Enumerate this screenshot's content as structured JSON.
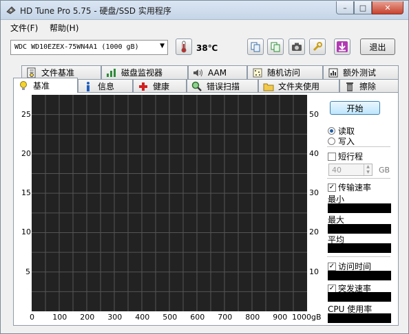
{
  "window": {
    "title": "HD Tune Pro 5.75 - 硬盘/SSD 实用程序",
    "minimize": "–",
    "maximize": "□",
    "close": "✕"
  },
  "menu": {
    "file": "文件(F)",
    "help": "帮助(H)"
  },
  "toolbar": {
    "drive": "WDC WD10EZEX-75WN4A1 (1000 gB)",
    "temperature": "38℃",
    "exit_label": "退出",
    "icons": [
      "copy-icon",
      "copy-all-icon",
      "camera-icon",
      "options-icon",
      "save-icon"
    ]
  },
  "tabs_top": [
    {
      "label": "文件基准",
      "icon": "file-benchmark-icon"
    },
    {
      "label": "磁盘监视器",
      "icon": "disk-monitor-icon"
    },
    {
      "label": "AAM",
      "icon": "speaker-icon"
    },
    {
      "label": "随机访问",
      "icon": "random-access-icon"
    },
    {
      "label": "额外测试",
      "icon": "extra-tests-icon"
    }
  ],
  "tabs_bottom": [
    {
      "label": "基准",
      "icon": "lightbulb-icon",
      "active": true
    },
    {
      "label": "信息",
      "icon": "info-icon"
    },
    {
      "label": "健康",
      "icon": "health-cross-icon"
    },
    {
      "label": "错误扫描",
      "icon": "magnifier-icon"
    },
    {
      "label": "文件夹使用",
      "icon": "folder-icon"
    },
    {
      "label": "擦除",
      "icon": "trash-icon"
    }
  ],
  "benchmark": {
    "start_label": "开始",
    "read_label": "读取",
    "write_label": "写入",
    "mode_selected": "read",
    "short_stroke_label": "短行程",
    "short_stroke_checked": false,
    "short_stroke_value": "40",
    "short_stroke_unit": "GB",
    "transfer_rate_label": "传输速率",
    "transfer_rate_checked": true,
    "min_label": "最小",
    "max_label": "最大",
    "avg_label": "平均",
    "access_time_label": "访问时间",
    "access_time_checked": true,
    "burst_rate_label": "突发速率",
    "burst_rate_checked": true,
    "cpu_usage_label": "CPU 使用率"
  },
  "chart_data": {
    "type": "line",
    "x_ticks": [
      "0",
      "100",
      "200",
      "300",
      "400",
      "500",
      "600",
      "700",
      "800",
      "900",
      "1000gB"
    ],
    "y_left_ticks": [
      "25",
      "20",
      "15",
      "10",
      "5"
    ],
    "y_right_ticks": [
      "50",
      "40",
      "30",
      "20",
      "10"
    ],
    "xlim": [
      0,
      1000
    ],
    "ylim_left": [
      0,
      27.5
    ],
    "ylim_right": [
      0,
      55
    ],
    "grid": true,
    "series": []
  },
  "colors": {
    "chart_bg": "#222222",
    "grid": "#555555",
    "accent": "#1c5fa8"
  }
}
